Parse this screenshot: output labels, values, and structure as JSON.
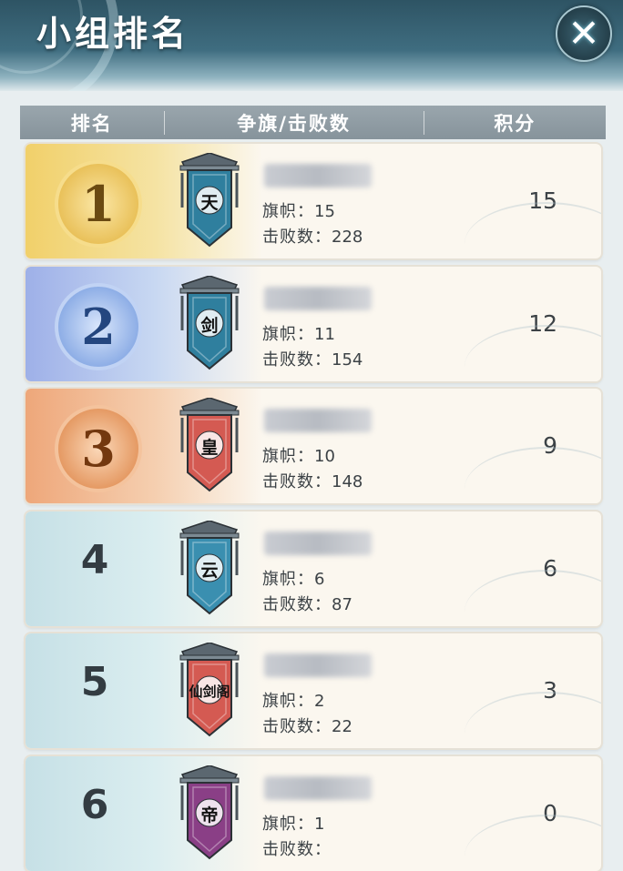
{
  "header": {
    "title": "小组排名",
    "close_icon": "close-icon"
  },
  "columns": {
    "rank": "排名",
    "flags_kills": "争旗/击败数",
    "score": "积分"
  },
  "labels": {
    "flags": "旗帜：",
    "kills": "击败数："
  },
  "rows": [
    {
      "rank": "1",
      "style": "gold",
      "banner_char": "天",
      "banner_color": "#2f7f9e",
      "flags": "15",
      "kills": "228",
      "score": "15"
    },
    {
      "rank": "2",
      "style": "silver",
      "banner_char": "剑",
      "banner_color": "#2f7f9e",
      "flags": "11",
      "kills": "154",
      "score": "12"
    },
    {
      "rank": "3",
      "style": "bronze",
      "banner_char": "皇",
      "banner_color": "#d45a52",
      "flags": "10",
      "kills": "148",
      "score": "9"
    },
    {
      "rank": "4",
      "style": "plain",
      "banner_char": "云",
      "banner_color": "#3a8fb0",
      "flags": "6",
      "kills": "87",
      "score": "6"
    },
    {
      "rank": "5",
      "style": "plain",
      "banner_char": "仙剑阁",
      "banner_color": "#d45a52",
      "flags": "2",
      "kills": "22",
      "score": "3"
    },
    {
      "rank": "6",
      "style": "plain",
      "banner_char": "帝",
      "banner_color": "#8a3f86",
      "flags": "1",
      "kills": "",
      "score": "0"
    }
  ]
}
